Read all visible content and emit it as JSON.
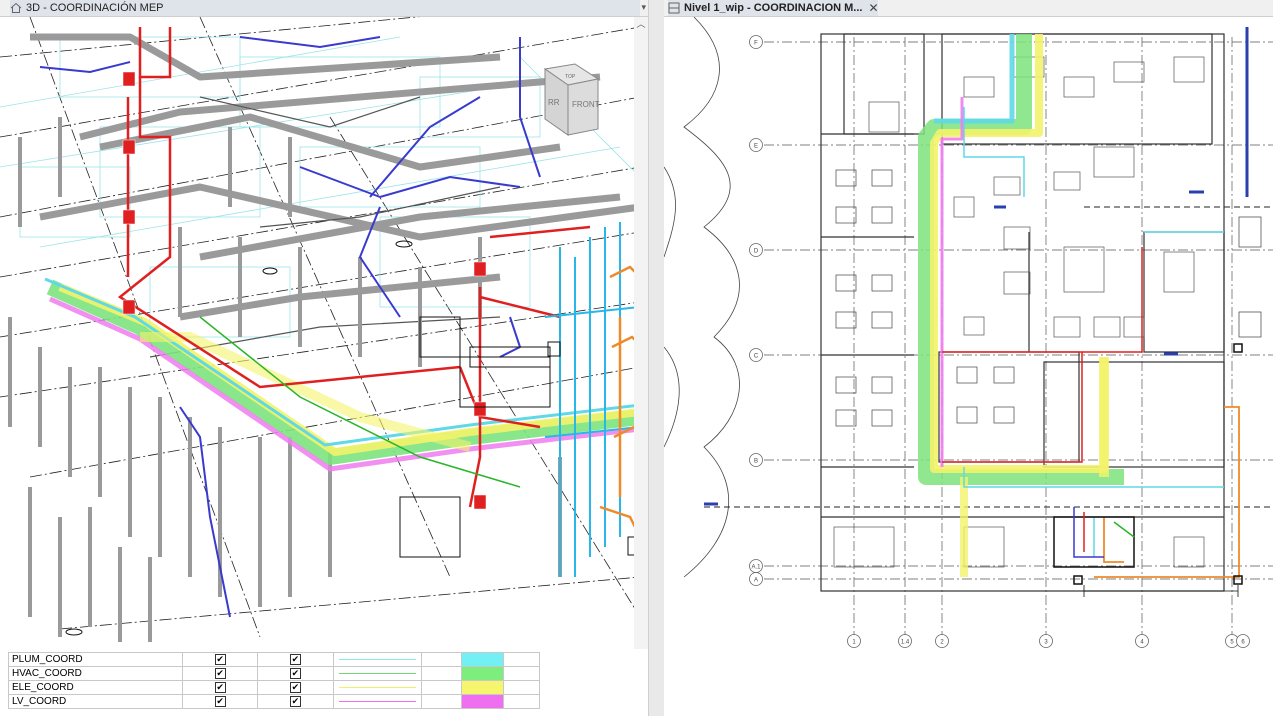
{
  "left_view": {
    "tab_title": "3D - COORDINACIÓN MEP",
    "view_cube": {
      "top": "TOP",
      "left": "RR",
      "front": "FRONT"
    }
  },
  "right_view": {
    "tab_title": "Nivel 1_wip - COORDINACION M...",
    "close_symbol": "✕",
    "grid_labels_left": [
      "F",
      "E",
      "D",
      "C",
      "B",
      "A.1",
      "A"
    ],
    "grid_labels_bottom": [
      "1",
      "1.4",
      "2",
      "3",
      "4",
      "5",
      "6"
    ]
  },
  "legend": {
    "rows": [
      {
        "name": "PLUM_COORD",
        "visible": "✔",
        "halftone": "✔",
        "line_color": "#8ee8e8",
        "fill_color": "#73f0f3"
      },
      {
        "name": "HVAC_COORD",
        "visible": "✔",
        "halftone": "✔",
        "line_color": "#6ed86e",
        "fill_color": "#7ded7d"
      },
      {
        "name": "ELE_COORD",
        "visible": "✔",
        "halftone": "✔",
        "line_color": "#f0f06a",
        "fill_color": "#f5f56e"
      },
      {
        "name": "LV_COORD",
        "visible": "✔",
        "halftone": "✔",
        "line_color": "#ef70ef",
        "fill_color": "#f06ef0"
      }
    ]
  },
  "colors": {
    "plumbing": "#5fd9e6",
    "hvac": "#7de37d",
    "electrical": "#f3f36a",
    "low_voltage": "#f07cf0",
    "fire_pipe": "#e02020",
    "blue_pipe": "#3a3acf",
    "orange_pipe": "#ee8a2a",
    "grey_structure": "#9a9a9a"
  }
}
